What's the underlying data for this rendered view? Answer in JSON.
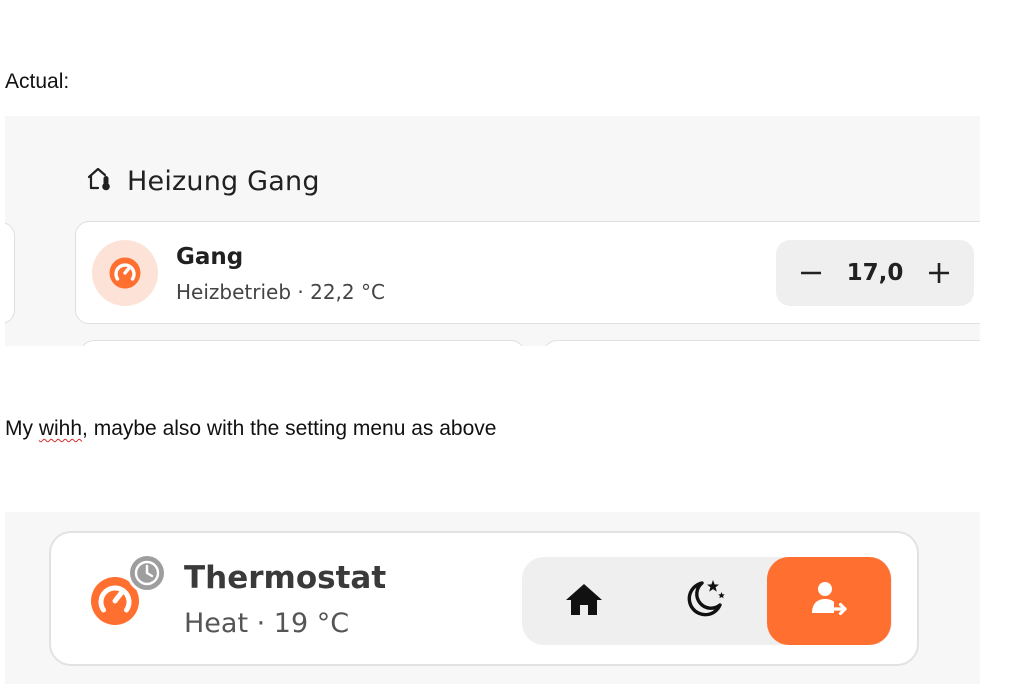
{
  "doc": {
    "actual_label": "Actual:",
    "wish_prefix": "My ",
    "wish_misspelled": "wihh",
    "wish_suffix": ", maybe also with the setting menu as above"
  },
  "actual": {
    "section_title": "Heizung Gang",
    "section_icon": "home-thermometer-icon",
    "card": {
      "name": "Gang",
      "state": "Heizbetrieb · 22,2 °C",
      "icon": "thermostat-icon",
      "setpoint": "17,0",
      "decrement_icon": "minus-icon",
      "increment_icon": "plus-icon"
    }
  },
  "wish": {
    "card": {
      "name": "Thermostat",
      "state": "Heat · 19 °C",
      "icon": "thermostat-icon",
      "status_icon": "clock-icon",
      "modes": [
        {
          "label": "home",
          "icon": "home-icon",
          "active": false
        },
        {
          "label": "sleep",
          "icon": "moon-stars-icon",
          "active": false
        },
        {
          "label": "away",
          "icon": "person-arrow-icon",
          "active": true
        }
      ]
    }
  },
  "colors": {
    "accent": "#ff6f30",
    "accent_soft": "#fde3d7",
    "panel_bg": "#f7f7f7",
    "stepper_bg": "#efefef",
    "clock_gray": "#9e9e9e"
  }
}
